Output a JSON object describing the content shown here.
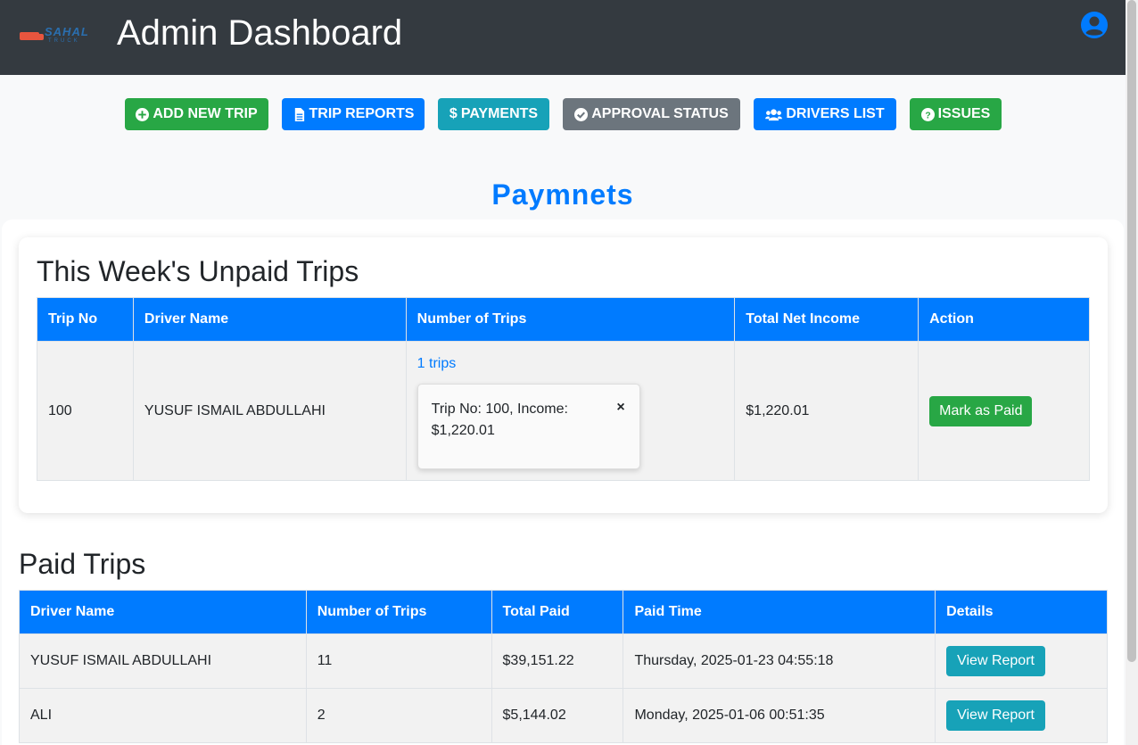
{
  "header": {
    "logo_text": "SAHAL",
    "logo_subtext": "TRUCK",
    "title": "Admin Dashboard"
  },
  "nav": {
    "add_new_trip": "ADD NEW TRIP",
    "trip_reports": "TRIP REPORTS",
    "payments": "PAYMENTS",
    "approval_status": "APPROVAL STATUS",
    "drivers_list": "DRIVERS LIST",
    "issues": "ISSUES"
  },
  "page_heading": "Paymnets",
  "unpaid": {
    "title": "This Week's Unpaid Trips",
    "columns": [
      "Trip No",
      "Driver Name",
      "Number of Trips",
      "Total Net Income",
      "Action"
    ],
    "rows": [
      {
        "trip_no": "100",
        "driver_name": "YUSUF ISMAIL ABDULLAHI",
        "trips_link": "1 trips",
        "popup_line1": "Trip No: 100, Income:",
        "popup_line2": "$1,220.01",
        "popup_close": "×",
        "total_net_income": "$1,220.01",
        "action": "Mark as Paid"
      }
    ]
  },
  "paid": {
    "title": "Paid Trips",
    "columns": [
      "Driver Name",
      "Number of Trips",
      "Total Paid",
      "Paid Time",
      "Details"
    ],
    "rows": [
      {
        "driver_name": "YUSUF ISMAIL ABDULLAHI",
        "number_of_trips": "11",
        "total_paid": "$39,151.22",
        "paid_time": "Thursday, 2025-01-23 04:55:18",
        "details": "View Report"
      },
      {
        "driver_name": "ALI",
        "number_of_trips": "2",
        "total_paid": "$5,144.02",
        "paid_time": "Monday, 2025-01-06 00:51:35",
        "details": "View Report"
      }
    ]
  },
  "colors": {
    "header_bg": "#343a40",
    "primary": "#007bff",
    "success": "#28a745",
    "info": "#17a2b8",
    "secondary": "#6c757d"
  }
}
